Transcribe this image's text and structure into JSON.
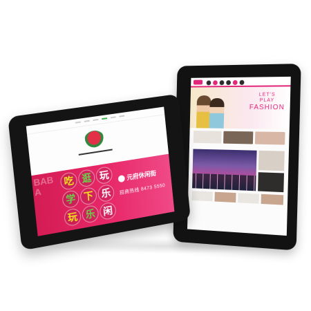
{
  "scene": {
    "accent_color": "#e2267a",
    "banner_color": "#d41c54",
    "bezel_color": "#141414"
  },
  "back_tablet": {
    "hero": {
      "line1": "LET'S",
      "line2": "PLAY",
      "line3": "FASHION"
    }
  },
  "front_tablet": {
    "banner": {
      "hand_lettering": "BABA",
      "chars": [
        "吃",
        "逛",
        "玩",
        "学",
        "下",
        "乐",
        "玩",
        "乐",
        "闲"
      ],
      "brand_name": "元府休闲街",
      "phone": "招商热线 8473 5550"
    }
  }
}
